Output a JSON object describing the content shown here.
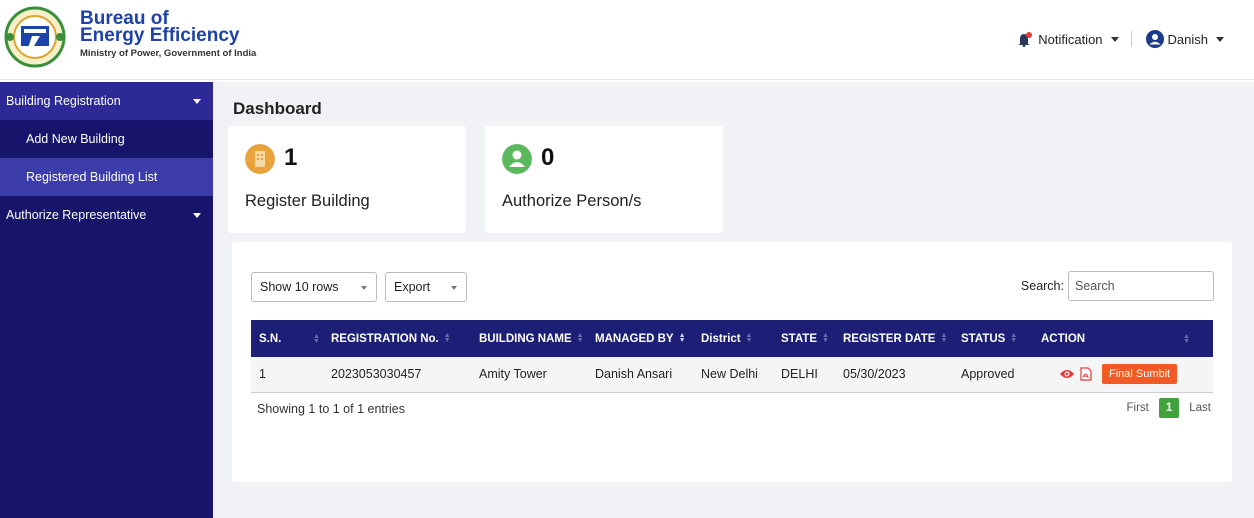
{
  "header": {
    "brand_line1": "Bureau of",
    "brand_line2": "Energy Efficiency",
    "brand_line3": "Ministry of Power, Government of India",
    "notification_label": "Notification",
    "user_name": "Danish"
  },
  "sidebar": {
    "items": [
      {
        "label": "Building Registration"
      },
      {
        "label": "Add New Building"
      },
      {
        "label": "Registered Building List"
      },
      {
        "label": "Authorize Representative"
      }
    ]
  },
  "main": {
    "title": "Dashboard",
    "cards": [
      {
        "value": "1",
        "label": "Register Building",
        "icon": "building-icon",
        "color": "#e8a33d"
      },
      {
        "value": "0",
        "label": "Authorize Person/s",
        "icon": "user-icon",
        "color": "#5cb85c"
      }
    ]
  },
  "table_controls": {
    "rows_select": "Show 10 rows",
    "export_select": "Export",
    "search_label": "Search:",
    "search_placeholder": "Search"
  },
  "table": {
    "headers": [
      "S.N.",
      "REGISTRATION No.",
      "BUILDING NAME",
      "MANAGED BY",
      "District",
      "STATE",
      "REGISTER DATE",
      "STATUS",
      "ACTION"
    ],
    "rows": [
      {
        "sn": "1",
        "reg_no": "2023053030457",
        "building": "Amity Tower",
        "managed_by": "Danish Ansari",
        "district": "New Delhi",
        "state": "DELHI",
        "date": "05/30/2023",
        "status": "Approved",
        "action_label": "Final Sumbit"
      }
    ],
    "info": "Showing 1 to 1 of 1 entries",
    "pager": {
      "first": "First",
      "current": "1",
      "last": "Last"
    }
  },
  "colors": {
    "sidebar": "#16146b",
    "table_header": "#1d1e75",
    "accent_orange": "#f15a24",
    "pager_green": "#41a13c",
    "brand_blue": "#1d42a8"
  }
}
